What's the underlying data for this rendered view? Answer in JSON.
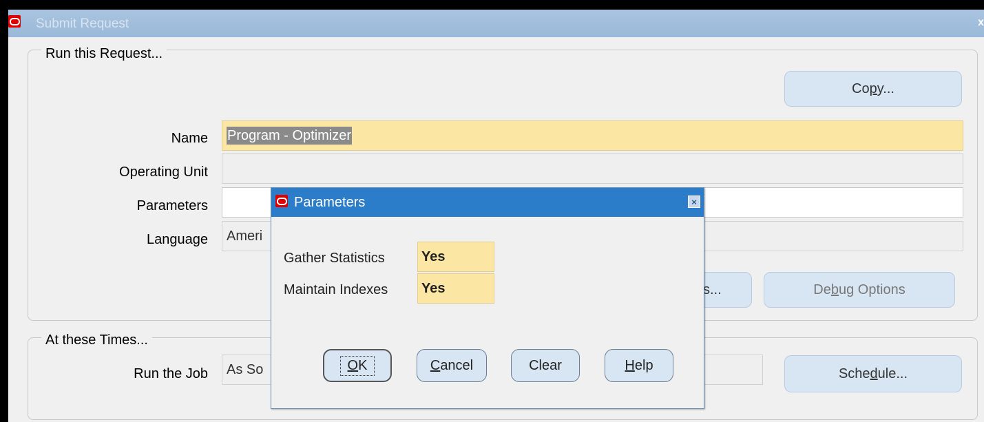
{
  "main_window": {
    "title": "Submit Request",
    "close_glyph": "x"
  },
  "run_group": {
    "label": "Run this Request...",
    "copy_button": {
      "pre": "Co",
      "mnemonic": "p",
      "post": "y..."
    },
    "fields": {
      "name": {
        "label": "Name",
        "value": "Program - Optimizer"
      },
      "operating_unit": {
        "label": "Operating Unit",
        "value": ""
      },
      "parameters": {
        "label": "Parameters",
        "value": ""
      },
      "language": {
        "label": "Language",
        "value": "Ameri"
      }
    },
    "options_button_partial": "s...",
    "debug_button": {
      "pre": "De",
      "mnemonic": "b",
      "post": "ug Options"
    }
  },
  "times_group": {
    "label": "At these Times...",
    "run_job": {
      "label": "Run the Job",
      "value": "As So"
    },
    "schedule_button": {
      "pre": "Sche",
      "mnemonic": "d",
      "post": "ule..."
    }
  },
  "dialog": {
    "title": "Parameters",
    "params": [
      {
        "label": "Gather Statistics",
        "value": "Yes"
      },
      {
        "label": "Maintain Indexes",
        "value": "Yes"
      }
    ],
    "buttons": {
      "ok": {
        "mnemonic": "O",
        "post": "K"
      },
      "cancel": {
        "mnemonic": "C",
        "post": "ancel"
      },
      "clear": {
        "label": "Clear"
      },
      "help": {
        "mnemonic": "H",
        "post": "elp"
      }
    }
  },
  "colors": {
    "required_field": "#fbe6a3",
    "dialog_titlebar": "#2b7dc9",
    "main_titlebar": "#a8c4e0",
    "button_fill": "#d8e6f4"
  }
}
